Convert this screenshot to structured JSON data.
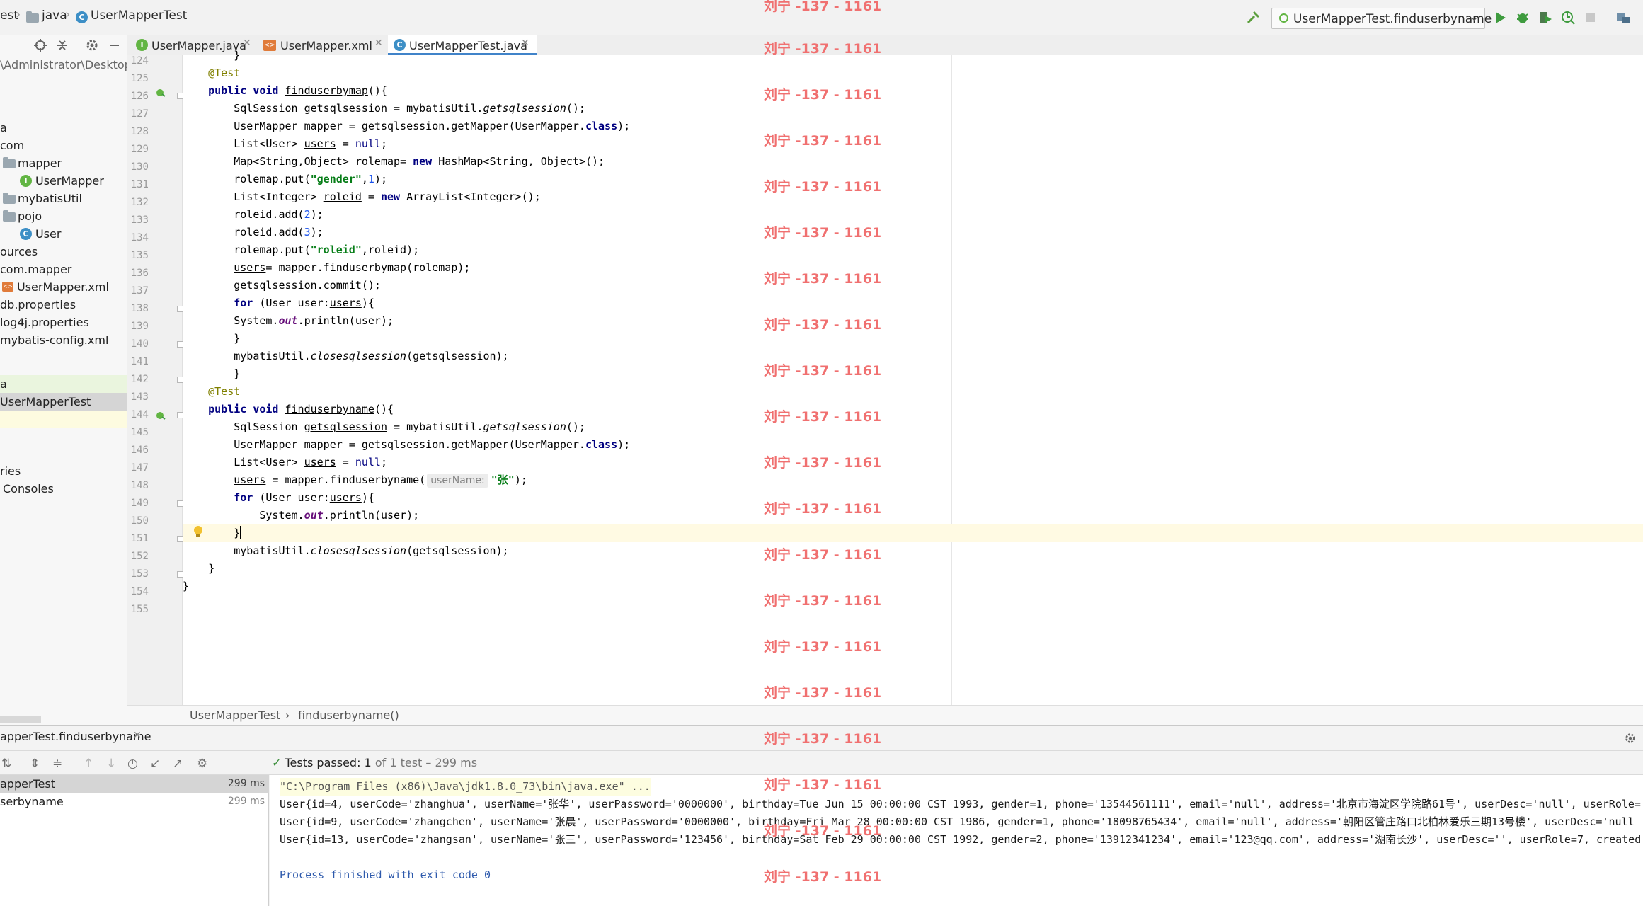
{
  "navbar": {
    "crumbs": [
      "est",
      "java",
      "UserMapperTest"
    ],
    "run_config": "UserMapperTest.finduserbyname"
  },
  "project": {
    "path_text": "\\Administrator\\Desktop",
    "items": [
      {
        "label": "a"
      },
      {
        "label": "com"
      },
      {
        "label": "mapper"
      },
      {
        "label": "UserMapper"
      },
      {
        "label": "mybatisUtil"
      },
      {
        "label": "pojo"
      },
      {
        "label": "User"
      },
      {
        "label": "ources"
      },
      {
        "label": "com.mapper"
      },
      {
        "label": "UserMapper.xml"
      },
      {
        "label": "db.properties"
      },
      {
        "label": "log4j.properties"
      },
      {
        "label": "mybatis-config.xml"
      },
      {
        "label": "a"
      },
      {
        "label": "UserMapperTest"
      },
      {
        "label": "ries"
      },
      {
        "label": "Consoles"
      }
    ]
  },
  "tabs": [
    {
      "label": "UserMapper.java"
    },
    {
      "label": "UserMapper.xml"
    },
    {
      "label": "UserMapperTest.java"
    }
  ],
  "editor": {
    "lines": [
      {
        "n": "124",
        "t": "        }"
      },
      {
        "n": "125",
        "t": "    @Test"
      },
      {
        "n": "126",
        "t": "    public void finduserbymap(){"
      },
      {
        "n": "127",
        "t": "        SqlSession getsqlsession = mybatisUtil.getsqlsession();"
      },
      {
        "n": "128",
        "t": "        UserMapper mapper = getsqlsession.getMapper(UserMapper.class);"
      },
      {
        "n": "129",
        "t": "        List<User> users = null;"
      },
      {
        "n": "130",
        "t": "        Map<String,Object> rolemap= new HashMap<String, Object>();"
      },
      {
        "n": "131",
        "t": "        rolemap.put(\"gender\",1);"
      },
      {
        "n": "132",
        "t": "        List<Integer> roleid = new ArrayList<Integer>();"
      },
      {
        "n": "133",
        "t": "        roleid.add(2);"
      },
      {
        "n": "134",
        "t": "        roleid.add(3);"
      },
      {
        "n": "135",
        "t": "        rolemap.put(\"roleid\",roleid);"
      },
      {
        "n": "136",
        "t": "        users= mapper.finduserbymap(rolemap);"
      },
      {
        "n": "137",
        "t": "        getsqlsession.commit();"
      },
      {
        "n": "138",
        "t": "        for (User user:users){"
      },
      {
        "n": "139",
        "t": "        System.out.println(user);"
      },
      {
        "n": "140",
        "t": "        }"
      },
      {
        "n": "141",
        "t": "        mybatisUtil.closesqlsession(getsqlsession);"
      },
      {
        "n": "142",
        "t": "        }"
      },
      {
        "n": "143",
        "t": "    @Test"
      },
      {
        "n": "144",
        "t": "    public void finduserbyname(){"
      },
      {
        "n": "145",
        "t": "        SqlSession getsqlsession = mybatisUtil.getsqlsession();"
      },
      {
        "n": "146",
        "t": "        UserMapper mapper = getsqlsession.getMapper(UserMapper.class);"
      },
      {
        "n": "147",
        "t": "        List<User> users = null;"
      },
      {
        "n": "148",
        "t": "        users = mapper.finduserbyname( userName: \"张\");"
      },
      {
        "n": "149",
        "t": "        for (User user:users){"
      },
      {
        "n": "150",
        "t": "            System.out.println(user);"
      },
      {
        "n": "151",
        "t": "        }"
      },
      {
        "n": "152",
        "t": "        mybatisUtil.closesqlsession(getsqlsession);"
      },
      {
        "n": "153",
        "t": "    }"
      },
      {
        "n": "154",
        "t": "}"
      },
      {
        "n": "155",
        "t": ""
      }
    ]
  },
  "breadcrumb": {
    "cls": "UserMapperTest",
    "sep": "›",
    "method": "finduserbyname()"
  },
  "run": {
    "title": "apperTest.finduserbyname",
    "status_label": "Tests passed:",
    "status_count": "1",
    "status_rest": "of 1 test – 299 ms",
    "tree": [
      {
        "label": "apperTest",
        "time": "299 ms"
      },
      {
        "label": "serbyname",
        "time": "299 ms"
      }
    ],
    "console": [
      "\"C:\\Program Files (x86)\\Java\\jdk1.8.0_73\\bin\\java.exe\" ...",
      "User{id=4, userCode='zhanghua', userName='张华', userPassword='0000000', birthday=Tue Jun 15 00:00:00 CST 1993, gender=1, phone='13544561111', email='null', address='北京市海淀区学院路61号', userDesc='null', userRole=",
      "User{id=9, userCode='zhangchen', userName='张晨', userPassword='0000000', birthday=Fri Mar 28 00:00:00 CST 1986, gender=1, phone='18098765434', email='null', address='朝阳区管庄路口北柏林爱乐三期13号楼', userDesc='null",
      "User{id=13, userCode='zhangsan', userName='张三', userPassword='123456', birthday=Sat Feb 29 00:00:00 CST 1992, gender=2, phone='13912341234', email='123@qq.com', address='湖南长沙', userDesc='', userRole=7, created",
      "",
      "Process finished with exit code 0"
    ]
  },
  "watermark": "刘宁 -137 - 1161",
  "colors": {
    "accent": "#4083c9",
    "pass": "#3d8f3d",
    "watermark": "#f07070",
    "keyword": "#000080",
    "string": "#067d17"
  }
}
